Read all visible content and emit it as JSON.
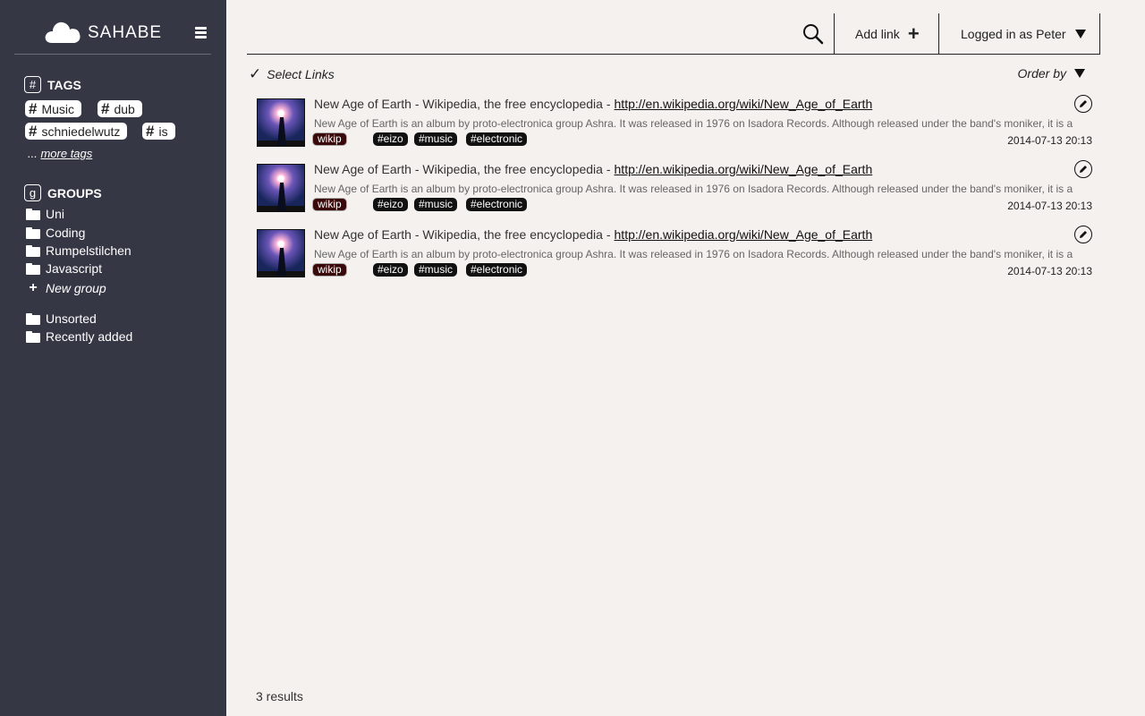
{
  "brand": {
    "name": "SAHABE"
  },
  "tags_section": {
    "title": "TAGS",
    "icon_glyph": "#",
    "items": [
      "Music",
      "dub",
      "schniedelwutz",
      "is"
    ],
    "more_prefix": "...",
    "more_label": "more tags"
  },
  "groups_section": {
    "title": "GROUPS",
    "icon_glyph": "g",
    "items": [
      "Uni",
      "Coding",
      "Rumpelstilchen",
      "Javascript"
    ],
    "new_group_label": "New group",
    "special_items": [
      "Unsorted",
      "Recently added"
    ]
  },
  "topbar": {
    "add_link_label": "Add link",
    "add_link_icon": "+",
    "user_label": "Logged in as Peter"
  },
  "subbar": {
    "select_label": "Select Links",
    "order_label": "Order by"
  },
  "links": [
    {
      "title": "New Age of Earth - Wikipedia, the free encyclopedia -",
      "url": "http://en.wikipedia.org/wiki/New_Age_of_Earth",
      "description": "New Age of Earth is an album by proto-electronica group Ashra. It was released in 1976 on Isadora Records. Although released under the band's moniker, it is a",
      "source": "wikip",
      "tags": [
        "#eizo",
        "#music",
        "#electronic"
      ],
      "date": "2014-07-13 20:13"
    },
    {
      "title": "New Age of Earth - Wikipedia, the free encyclopedia -",
      "url": "http://en.wikipedia.org/wiki/New_Age_of_Earth",
      "description": "New Age of Earth is an album by proto-electronica group Ashra. It was released in 1976 on Isadora Records. Although released under the band's moniker, it is a",
      "source": "wikip",
      "tags": [
        "#eizo",
        "#music",
        "#electronic"
      ],
      "date": "2014-07-13 20:13"
    },
    {
      "title": "New Age of Earth - Wikipedia, the free encyclopedia -",
      "url": "http://en.wikipedia.org/wiki/New_Age_of_Earth",
      "description": "New Age of Earth is an album by proto-electronica group Ashra. It was released in 1976 on Isadora Records. Although released under the band's moniker, it is a",
      "source": "wikip",
      "tags": [
        "#eizo",
        "#music",
        "#electronic"
      ],
      "date": "2014-07-13 20:13"
    }
  ],
  "footer": {
    "results_label": "3 results"
  },
  "colors": {
    "sidebar_bg": "#363745",
    "main_bg": "#f4f1ee",
    "tag_chip_bg": "#111111",
    "source_chip_bg": "#3a0a0a"
  },
  "icons": {
    "logo": "cloud-icon",
    "menu": "hamburger-icon",
    "search": "search-icon",
    "edit": "pencil-icon",
    "folder": "folder-icon",
    "check": "checkmark-icon",
    "caret": "caret-down-icon"
  }
}
